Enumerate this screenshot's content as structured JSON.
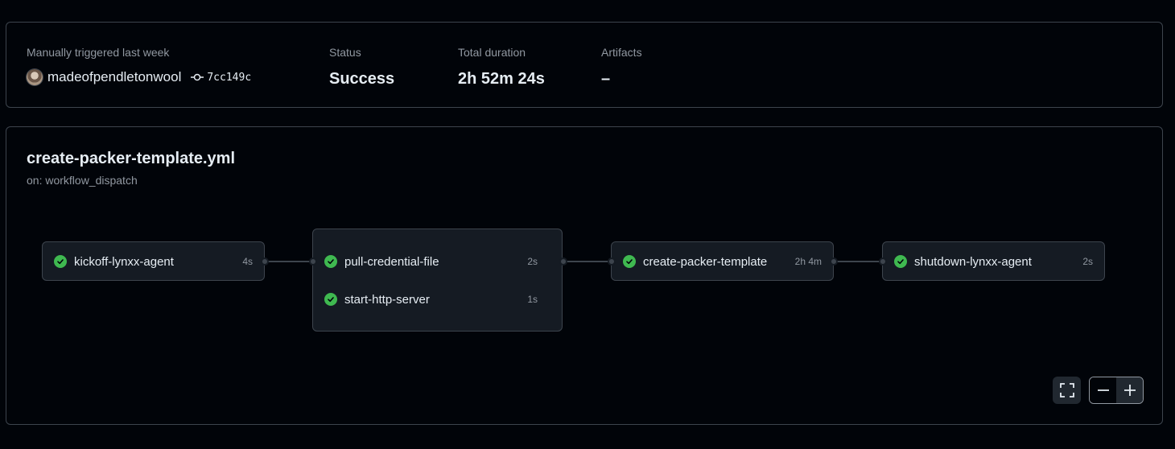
{
  "summary": {
    "trigger_label": "Manually triggered last week",
    "username": "madeofpendletonwool",
    "commit_sha": "7cc149c",
    "status_label": "Status",
    "status_value": "Success",
    "duration_label": "Total duration",
    "duration_value": "2h 52m 24s",
    "artifacts_label": "Artifacts",
    "artifacts_value": "–"
  },
  "workflow": {
    "file": "create-packer-template.yml",
    "trigger": "on: workflow_dispatch"
  },
  "jobs": [
    {
      "name": "kickoff-lynxx-agent",
      "duration": "4s",
      "status": "success"
    },
    {
      "name": "pull-credential-file",
      "duration": "2s",
      "status": "success"
    },
    {
      "name": "start-http-server",
      "duration": "1s",
      "status": "success"
    },
    {
      "name": "create-packer-template",
      "duration": "2h 4m",
      "status": "success"
    },
    {
      "name": "shutdown-lynxx-agent",
      "duration": "2s",
      "status": "success"
    }
  ],
  "colors": {
    "success": "#3fb950",
    "background": "#010409",
    "job_bg": "#151b23",
    "border": "#3d444d"
  },
  "icons": {
    "commit": "git-commit-icon",
    "check": "check-circle-icon",
    "fullscreen": "fullscreen-icon",
    "zoom_out": "minus-icon",
    "zoom_in": "plus-icon"
  }
}
